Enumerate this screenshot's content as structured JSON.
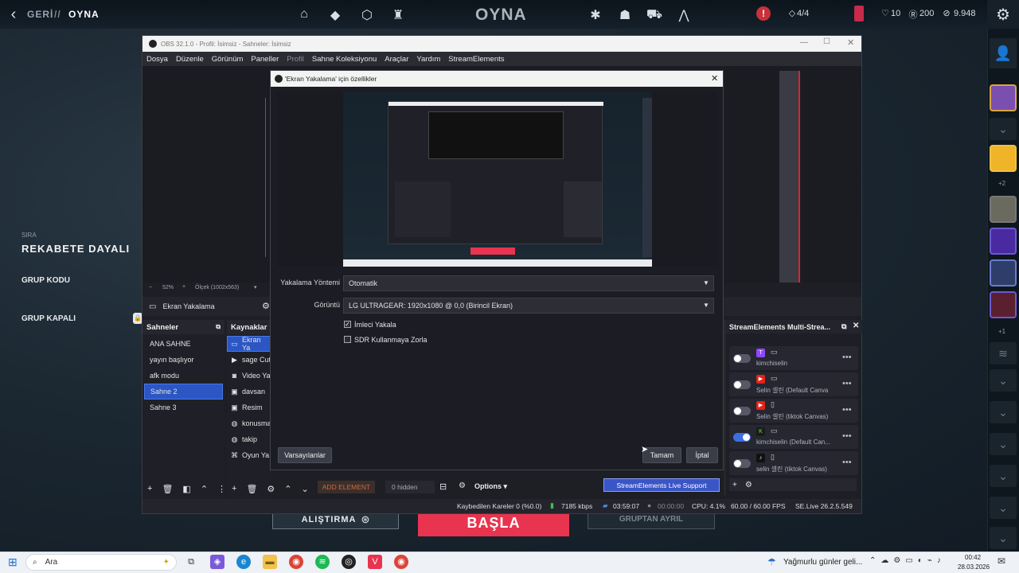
{
  "game": {
    "back_label": "GERİ",
    "separator": "//",
    "current_page": "OYNA",
    "center_title": "OYNA",
    "party_count": "4/4",
    "stat_a": "10",
    "stat_b": "200",
    "stat_c": "9.948",
    "queue_label": "SIRA",
    "queue_value": "REKABETE DAYALI",
    "group_code_label": "GRUP KODU",
    "group_closed_label": "GRUP KAPALI",
    "practice_label": "ALIŞTIRMA",
    "start_label": "BAŞLA",
    "leave_group_label": "GRUPTAN AYRIL",
    "rail_plus": "+2",
    "rail_plus2": "+1"
  },
  "obs": {
    "title": "OBS 32.1.0 - Profil: İsimsiz - Sahneler: İsimsiz",
    "menu": [
      "Dosya",
      "Düzenle",
      "Görünüm",
      "Paneller",
      "Profil",
      "Sahne Koleksiyonu",
      "Araçlar",
      "Yardım",
      "StreamElements"
    ],
    "zoom": "52%",
    "canvas_size": "Ölçek (1002x563)",
    "selected_source_bar": "Ekran Yakalama",
    "scenes_header": "Sahneler",
    "scenes": [
      "ANA SAHNE",
      "yayın başlıyor",
      "afk modu",
      "Sahne 2",
      "Sahne 3"
    ],
    "selected_scene": "Sahne 2",
    "sources_header": "Kaynaklar",
    "sources": [
      "Ekran Ya",
      "sage Cut",
      "Video Ya",
      "davsan",
      "Resim",
      "konusma",
      "takip",
      "Oyun Ya"
    ],
    "add_element": "ADD ELEMENT",
    "hidden_count": "0 hidden",
    "options_label": "Options",
    "se_support": "StreamElements Live Support",
    "status": {
      "dropped_frames": "Kaybedilen Kareler 0 (%0.0)",
      "bitrate": "7185 kbps",
      "stream_time": "03:59:07",
      "rec_time": "00:00:00",
      "cpu": "CPU: 4.1%",
      "fps": "60.00 / 60.00 FPS",
      "version": "SE.Live 26.2.5.549"
    }
  },
  "dialog": {
    "title": "'Ekran Yakalama' için özellikler",
    "capture_method_label": "Yakalama Yöntemi",
    "capture_method_value": "Otomatik",
    "display_label": "Görüntü",
    "display_value": "LG ULTRAGEAR: 1920x1080 @ 0,0 (Birincil Ekran)",
    "capture_cursor_label": "İmleci Yakala",
    "capture_cursor_checked": true,
    "sdr_label": "SDR Kullanmaya Zorla",
    "sdr_checked": false,
    "defaults_button": "Varsayılanlar",
    "ok_button": "Tamam",
    "cancel_button": "İptal"
  },
  "streamelements": {
    "title": "StreamElements Multi-Strea...",
    "outputs": [
      {
        "platform": "twitch",
        "device": "desktop",
        "name": "kimchiselin",
        "enabled": false,
        "color": "#9146ff",
        "glyph": "T"
      },
      {
        "platform": "youtube",
        "device": "desktop",
        "name": "Selin 셀린 (Default Canva",
        "enabled": false,
        "color": "#e62117",
        "glyph": "▶"
      },
      {
        "platform": "youtube",
        "device": "mobile",
        "name": "Selin 셀린 (tiktok Canvas)",
        "enabled": false,
        "color": "#e62117",
        "glyph": "▶"
      },
      {
        "platform": "kick",
        "device": "desktop",
        "name": "kimchiselin (Default Can...",
        "enabled": true,
        "color": "#1b1b1b",
        "glyph": "K"
      },
      {
        "platform": "tiktok",
        "device": "mobile",
        "name": "selin 셀린 (tiktok Canvas)",
        "enabled": false,
        "color": "#111111",
        "glyph": "♪"
      }
    ]
  },
  "taskbar": {
    "search_placeholder": "Ara",
    "weather": "Yağmurlu günler geli...",
    "time": "00:42",
    "date": "28.03.2026"
  }
}
